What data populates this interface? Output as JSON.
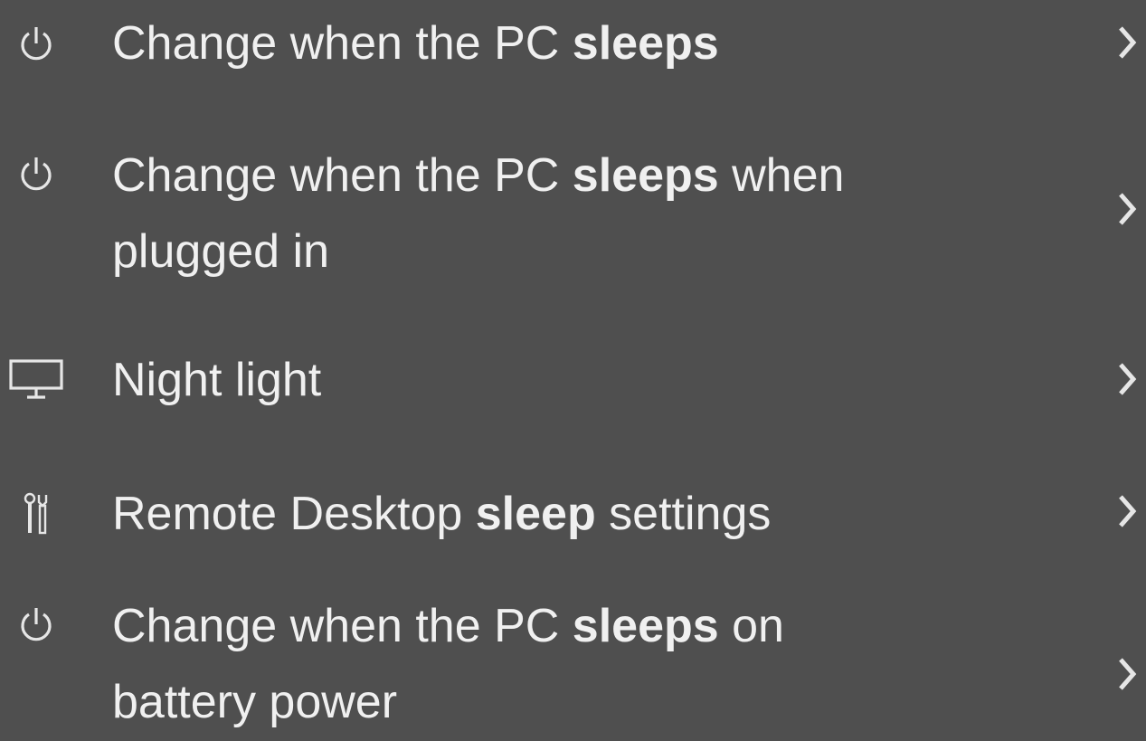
{
  "results": [
    {
      "icon": "power-icon",
      "prefix": "Change when the PC ",
      "highlight": "sleeps",
      "suffix": ""
    },
    {
      "icon": "power-icon",
      "prefix": "Change when the PC ",
      "highlight": "sleeps",
      "suffix": " when plugged in"
    },
    {
      "icon": "monitor-icon",
      "prefix": "Night light",
      "highlight": "",
      "suffix": ""
    },
    {
      "icon": "remote-settings-icon",
      "prefix": "Remote Desktop ",
      "highlight": "sleep",
      "suffix": " settings"
    },
    {
      "icon": "power-icon",
      "prefix": "Change when the PC ",
      "highlight": "sleeps",
      "suffix": " on battery power"
    }
  ],
  "colors": {
    "background": "#4f4f4f",
    "text": "#f0f0f0",
    "icon": "#e6e6e6"
  }
}
